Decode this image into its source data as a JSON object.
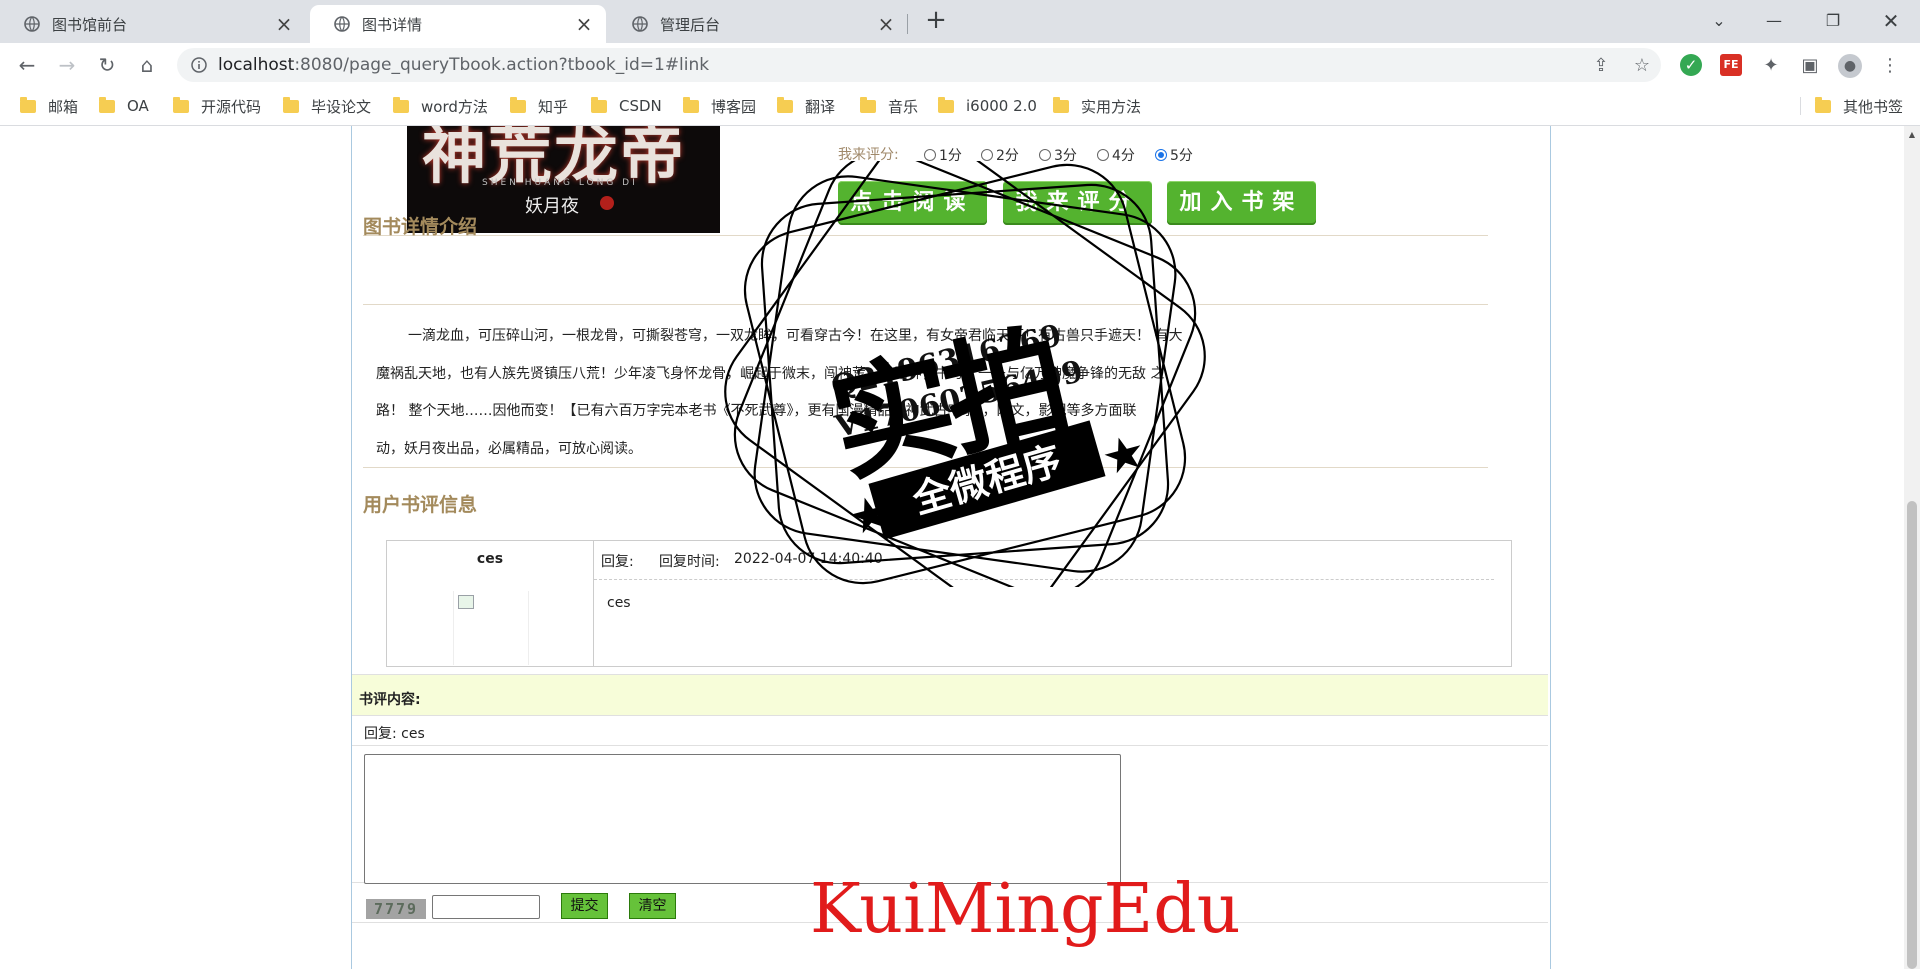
{
  "browser": {
    "tabs": [
      {
        "title": "图书馆前台",
        "active": false
      },
      {
        "title": "图书详情",
        "active": true
      },
      {
        "title": "管理后台",
        "active": false
      }
    ],
    "url_host": "localhost",
    "url_rest": ":8080/page_queryTbook.action?tbook_id=1#link",
    "bookmarks": [
      "邮箱",
      "OA",
      "开源代码",
      "毕设论文",
      "word方法",
      "知乎",
      "CSDN",
      "博客园",
      "翻译",
      "音乐",
      "i6000 2.0",
      "实用方法"
    ],
    "other_bookmarks": "其他书签"
  },
  "book": {
    "cover": {
      "title": "神荒龙帝",
      "subtitle": "SHEN HUANG LONG DI",
      "author": "妖月夜"
    },
    "rating": {
      "label": "我来评分:",
      "options": [
        "1分",
        "2分",
        "3分",
        "4分",
        "5分"
      ],
      "selected": "5分"
    },
    "buttons": {
      "read": "点击阅读",
      "rate": "我来评分",
      "shelf": "加入书架"
    },
    "detail_title": "图书详情介绍",
    "intro_lines": [
      "一滴龙血，可压碎山河，一根龙骨，可撕裂苍穹，一双龙眸，可看穿古今！在这里，有女帝君临天下！有古兽只手遮天！  有大",
      "魔祸乱天地，也有人族先贤镇压八荒！少年凌飞身怀龙骨，崛起于微末，闯神荒，战诸神，书写了一条与亿万神魔争锋的无敌 之",
      "路！ 整个天地……因他而变！【已有六百万字完本老书《不死武尊》，更有国漫精品《神武古宅录》，网文，影视等多方面联",
      "动，妖月夜出品，必属精品，可放心阅读。"
    ]
  },
  "comments": {
    "title": "用户书评信息",
    "items": [
      {
        "user": "ces",
        "reply_label": "回复:",
        "reply_time_label": "回复时间:",
        "reply_time": "2022-04-07 14:40:40",
        "content": "ces"
      }
    ]
  },
  "form": {
    "label": "书评内容:",
    "reply_prefix": "回复: ces",
    "captcha": "7779",
    "submit": "提交",
    "clear": "清空"
  },
  "watermark": {
    "line1": "Q2196316269",
    "line2": "V17060256499",
    "big": "实拍",
    "ribbon": "全微程序",
    "brand": "KuiMingEdu"
  }
}
